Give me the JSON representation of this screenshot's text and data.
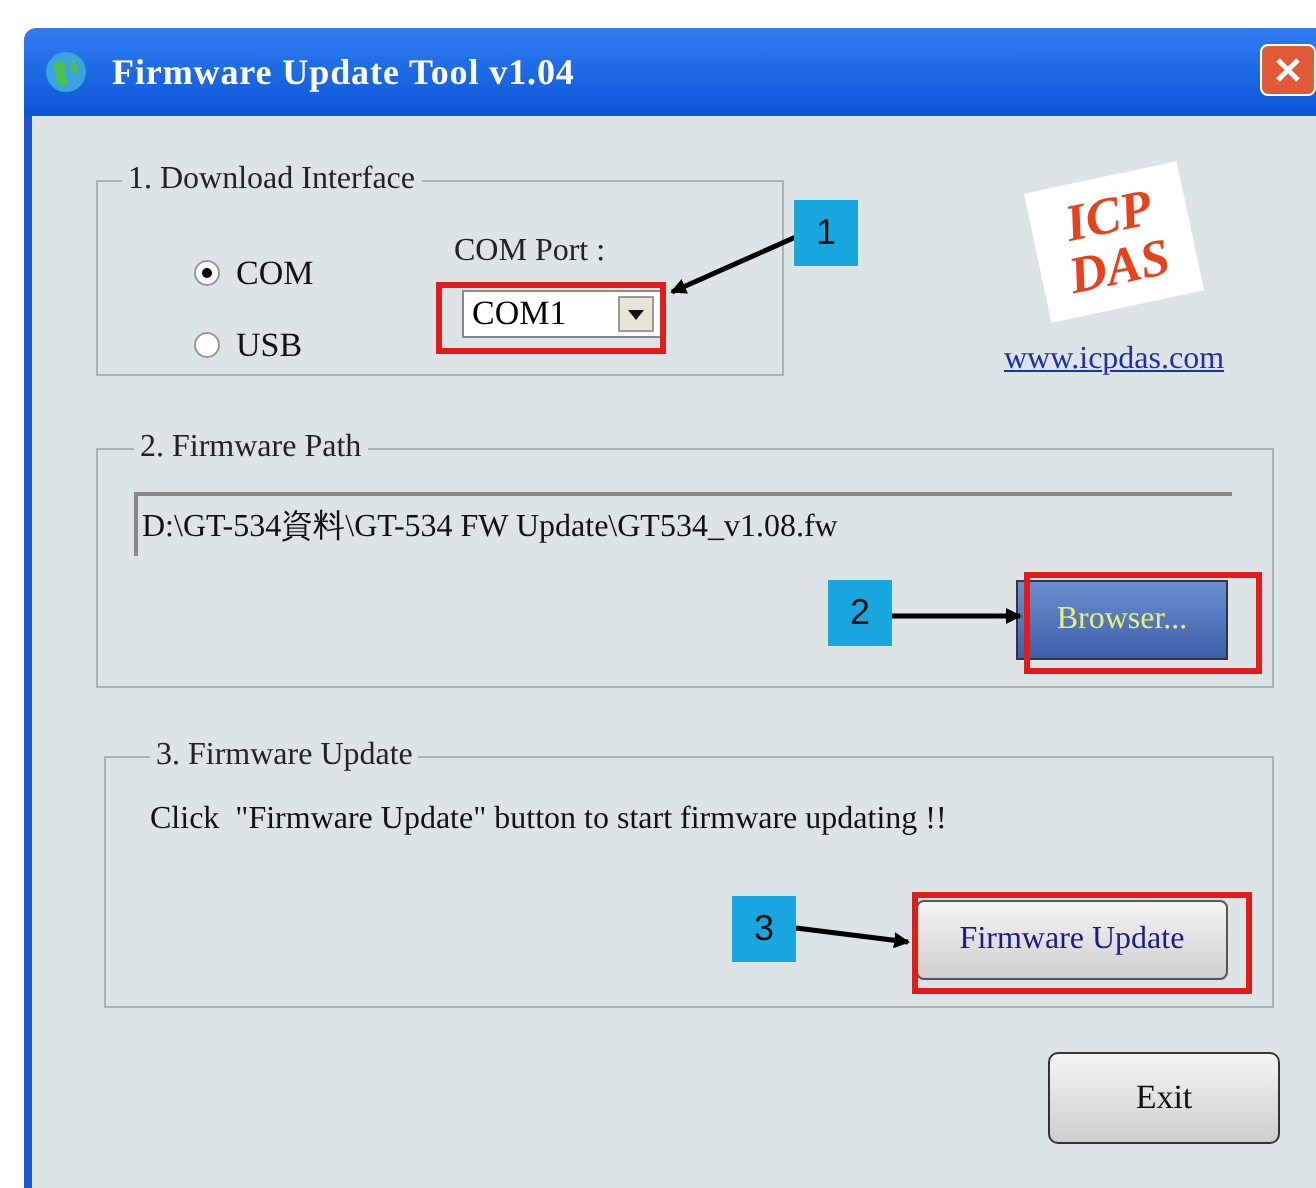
{
  "window": {
    "title": "Firmware Update Tool v1.04"
  },
  "download_interface": {
    "legend": "1. Download Interface",
    "options": [
      {
        "label": "COM",
        "selected": true
      },
      {
        "label": "USB",
        "selected": false
      }
    ],
    "com_port_label": "COM Port :",
    "com_port_value": "COM1"
  },
  "logo": {
    "lines": [
      "ICP",
      "DAS"
    ],
    "link": "www.icpdas.com"
  },
  "firmware_path": {
    "legend": "2. Firmware Path",
    "value": "D:\\GT-534資料\\GT-534 FW Update\\GT534_v1.08.fw",
    "button": "Browser..."
  },
  "firmware_update": {
    "legend": "3. Firmware Update",
    "message": "Click  \"Firmware Update\" button to start firmware updating !!",
    "button": "Firmware Update"
  },
  "exit_button": "Exit",
  "annotations": [
    {
      "number": "1"
    },
    {
      "number": "2"
    },
    {
      "number": "3"
    }
  ]
}
